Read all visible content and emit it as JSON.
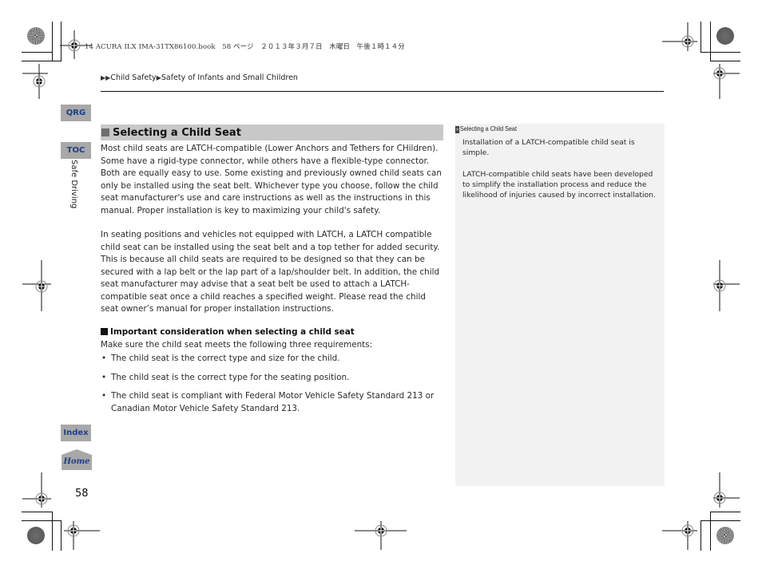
{
  "print_header": "14 ACURA ILX IMA-31TX86100.book　58 ページ　２０１３年３月７日　木曜日　午後１時１４分",
  "breadcrumb": {
    "items": [
      "Child Safety",
      "Safety of Infants and Small Children"
    ]
  },
  "side_nav": {
    "qrg": "QRG",
    "toc": "TOC",
    "index": "Index",
    "home": "Home",
    "section_label": "Safe Driving"
  },
  "page_number": "58",
  "main": {
    "heading": "Selecting a Child Seat",
    "paragraph1": "Most child seats are LATCH-compatible (Lower Anchors and Tethers for CHildren). Some have a rigid-type connector, while others have a flexible-type connector. Both are equally easy to use. Some existing and previously owned child seats can only be installed using the seat belt. Whichever type you choose, follow the child seat manufacturer's use and care instructions as well as the instructions in this manual. Proper installation is key to maximizing your child's safety.",
    "paragraph2": "In seating positions and vehicles not equipped with LATCH, a LATCH compatible child seat can be installed using the seat belt and a top tether for added security. This is because all child seats are required to be designed so that they can be secured with a lap belt or the lap part of a lap/shoulder belt. In addition, the child seat manufacturer may advise that a seat belt be used to attach a LATCH-compatible seat once a child reaches a specified weight. Please read the child seat owner’s manual for proper installation instructions.",
    "subheading": "Important consideration when selecting a child seat",
    "intro": "Make sure the child seat meets the following three requirements:",
    "requirements": [
      "The child seat is the correct type and size for the child.",
      "The child seat is the correct type for the seating position.",
      "The child seat is compliant with Federal Motor Vehicle Safety Standard 213 or Canadian Motor Vehicle Safety Standard 213."
    ]
  },
  "note": {
    "title": "Selecting a Child Seat",
    "paragraphs": [
      "Installation of a LATCH-compatible child seat is simple.",
      "LATCH-compatible child seats have been developed to simplify the installation process and reduce the likelihood of injuries caused by incorrect installation."
    ]
  },
  "colors": {
    "nav_tab_bg": "#a8a8a8",
    "nav_tab_text": "#1c3f8a",
    "heading_bar": "#c8c8c8",
    "note_bg": "#f2f2f2"
  }
}
